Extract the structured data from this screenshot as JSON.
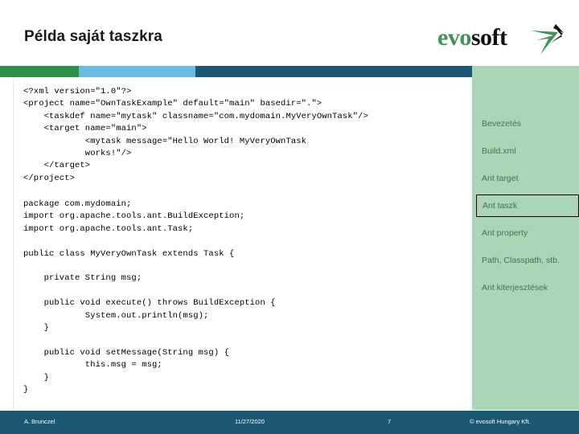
{
  "slide": {
    "title": "Példa saját taszkra"
  },
  "logo": {
    "part_green": "evo",
    "part_black": "soft",
    "mark_icon": "evosoft-arrow-mark"
  },
  "band": {
    "colors": [
      "#2e9148",
      "#69bde4",
      "#1c5773",
      "#a9d6b4"
    ]
  },
  "content": {
    "xml_code": "<?xml version=\"1.0\"?>\n<project name=\"OwnTaskExample\" default=\"main\" basedir=\".\">\n    <taskdef name=\"mytask\" classname=\"com.mydomain.MyVeryOwnTask\"/>\n    <target name=\"main\">\n            <mytask message=\"Hello World! MyVeryOwnTask\n            works!\"/>\n    </target>\n</project>",
    "java_code": "package com.mydomain;\nimport org.apache.tools.ant.BuildException;\nimport org.apache.tools.ant.Task;\n\npublic class MyVeryOwnTask extends Task {\n\n    private String msg;\n\n    public void execute() throws BuildException {\n            System.out.println(msg);\n    }\n\n    public void setMessage(String msg) {\n            this.msg = msg;\n    }\n}"
  },
  "sidebar": {
    "background_color": "#a9d6b4",
    "items": [
      {
        "label": "Bevezetés",
        "active": false
      },
      {
        "label": "Build.xml",
        "active": false
      },
      {
        "label": "Ant target",
        "active": false
      },
      {
        "label": "Ant taszk",
        "active": true
      },
      {
        "label": "Ant property",
        "active": false
      },
      {
        "label": "Path, Classpath, stb.",
        "active": false
      },
      {
        "label": "Ant kiterjesztések",
        "active": false
      }
    ]
  },
  "footer": {
    "background_color": "#1c5773",
    "author": "A. Brunczel",
    "date": "11/27/2020",
    "page_number": "7",
    "copyright": "© evosoft Hungary Kft."
  }
}
